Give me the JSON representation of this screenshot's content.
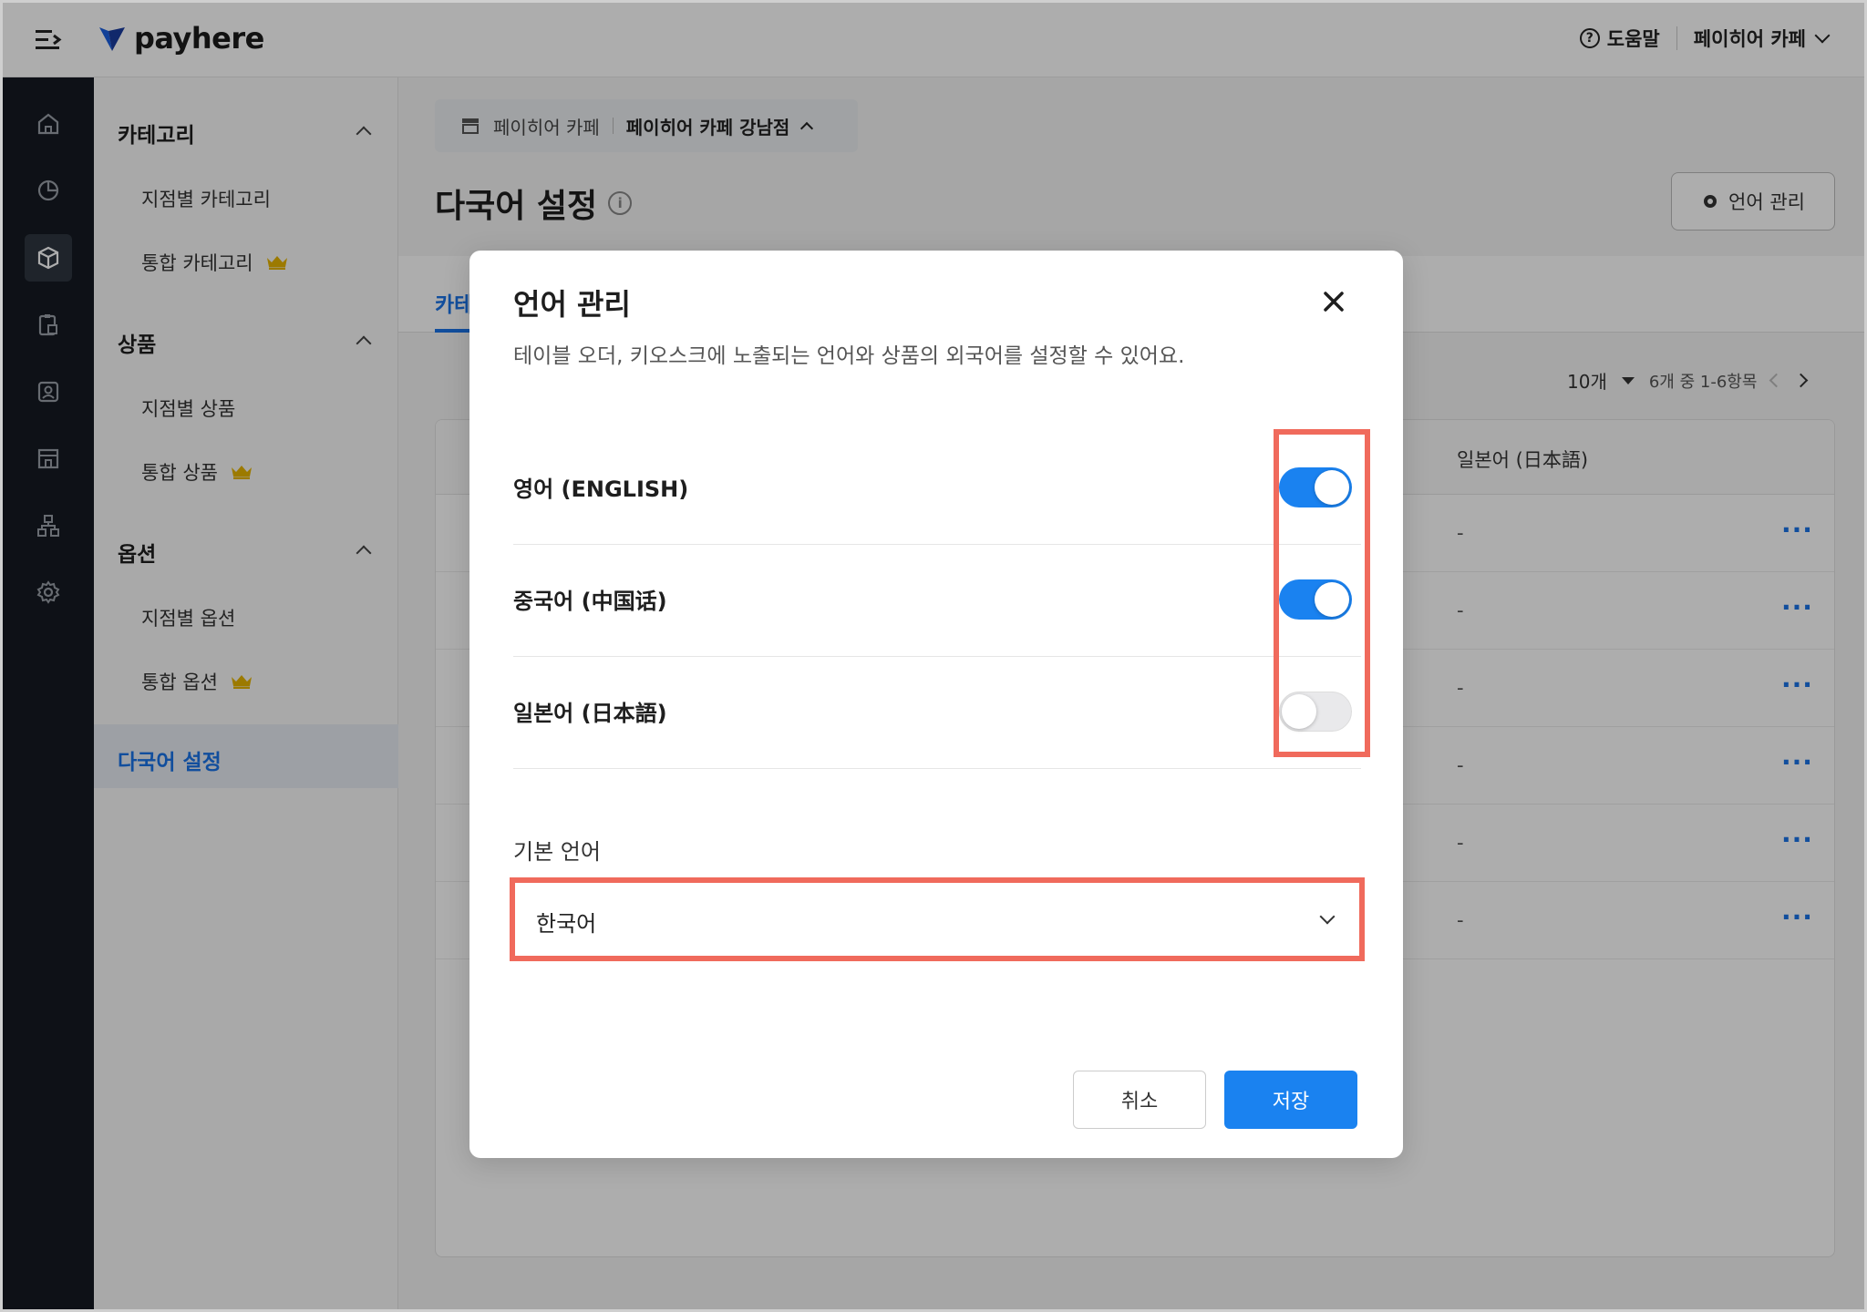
{
  "app": {
    "brand": "payhere",
    "help_label": "도움말",
    "store_name": "페이히어 카페"
  },
  "sidebar": {
    "sections": [
      {
        "label": "카테고리",
        "items": [
          {
            "label": "지점별 카테고리",
            "premium": false
          },
          {
            "label": "통합 카테고리",
            "premium": true
          }
        ]
      },
      {
        "label": "상품",
        "items": [
          {
            "label": "지점별 상품",
            "premium": false
          },
          {
            "label": "통합 상품",
            "premium": true
          }
        ]
      },
      {
        "label": "옵션",
        "items": [
          {
            "label": "지점별 옵션",
            "premium": false
          },
          {
            "label": "통합 옵션",
            "premium": true
          }
        ]
      }
    ],
    "active_item": "다국어 설정"
  },
  "rail": {
    "icons": [
      "home-icon",
      "chart-icon",
      "box-icon",
      "clipboard-icon",
      "contact-icon",
      "store-icon",
      "org-icon",
      "gear-icon"
    ],
    "active_index": 2
  },
  "main": {
    "breadcrumb": {
      "brand": "페이히어 카페",
      "branch": "페이히어 카페 강남점"
    },
    "page_title": "다국어 설정",
    "lang_manage_button": "언어 관리",
    "tab_label": "카테",
    "pager": {
      "page_size": "10개",
      "range": "6개 중 1-6항목"
    },
    "table": {
      "column_japanese": "일본어 (日本語)",
      "rows": [
        "-",
        "-",
        "-",
        "-",
        "-",
        "-"
      ],
      "more_label": "···"
    }
  },
  "modal": {
    "title": "언어 관리",
    "description": "테이블 오더, 키오스크에 노출되는 언어와 상품의 외국어를 설정할 수 있어요.",
    "languages": [
      {
        "name": "영어 (ENGLISH)",
        "enabled": true
      },
      {
        "name": "중국어 (中国话)",
        "enabled": true
      },
      {
        "name": "일본어 (日本語)",
        "enabled": false
      }
    ],
    "default_language_label": "기본 언어",
    "default_language_value": "한국어",
    "cancel_label": "취소",
    "save_label": "저장"
  },
  "colors": {
    "accent": "#1a82f0",
    "highlight": "#f06a5c",
    "rail_bg": "#151a22"
  }
}
